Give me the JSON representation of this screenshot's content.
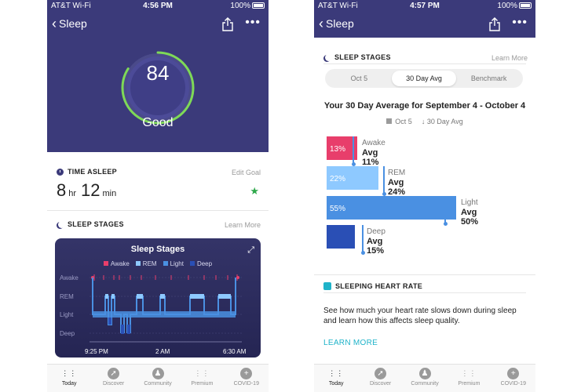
{
  "status_left": {
    "carrier": "AT&T Wi-Fi",
    "time": "4:56 PM",
    "battery": "100%"
  },
  "status_right": {
    "carrier": "AT&T Wi-Fi",
    "time": "4:57 PM",
    "battery": "100%"
  },
  "nav": {
    "back_label": "Sleep"
  },
  "score": {
    "value": "84",
    "label": "Good",
    "progress": 0.84
  },
  "time_asleep": {
    "heading": "TIME ASLEEP",
    "edit_link": "Edit Goal",
    "hours": "8",
    "hours_unit": "hr",
    "minutes": "12",
    "minutes_unit": "min"
  },
  "sleep_stages_left": {
    "heading": "SLEEP STAGES",
    "link": "Learn More",
    "chart_title": "Sleep Stages",
    "legend": [
      {
        "label": "Awake",
        "color": "#e83e6b"
      },
      {
        "label": "REM",
        "color": "#8ec9ff"
      },
      {
        "label": "Light",
        "color": "#4a90e2"
      },
      {
        "label": "Deep",
        "color": "#2a4fb5"
      }
    ],
    "row_labels": [
      "Awake",
      "REM",
      "Light",
      "Deep"
    ],
    "time_labels": [
      "9:25 PM",
      "2 AM",
      "6:30 AM"
    ]
  },
  "sleep_stages_right": {
    "heading": "SLEEP STAGES",
    "link": "Learn More",
    "tabs": [
      {
        "label": "Oct 5",
        "active": false
      },
      {
        "label": "30 Day Avg",
        "active": true
      },
      {
        "label": "Benchmark",
        "active": false
      }
    ],
    "avg_title": "Your 30 Day Average for September 4 - October 4",
    "legend_day": "Oct 5",
    "legend_avg": "30 Day Avg",
    "stages": [
      {
        "name": "Awake",
        "pct_label": "13%",
        "pct": 13,
        "avg_label": "Avg 11%",
        "avg": 11,
        "color": "#e83e6b"
      },
      {
        "name": "REM",
        "pct_label": "22%",
        "pct": 22,
        "avg_label": "Avg 24%",
        "avg": 24,
        "color": "#8ec9ff"
      },
      {
        "name": "Light",
        "pct_label": "55%",
        "pct": 55,
        "avg_label": "Avg 50%",
        "avg": 50,
        "color": "#4a90e2"
      },
      {
        "name": "Deep",
        "pct_label": "",
        "pct": 12,
        "avg_label": "Avg 15%",
        "avg": 15,
        "color": "#2a4fb5"
      }
    ]
  },
  "heart_rate": {
    "heading": "SLEEPING HEART RATE",
    "body": "See how much your heart rate slows down during sleep and learn how this affects sleep quality.",
    "link": "LEARN MORE"
  },
  "tabbar": [
    {
      "label": "Today",
      "icon": "dots-icon",
      "active": true
    },
    {
      "label": "Discover",
      "icon": "compass-icon",
      "active": false
    },
    {
      "label": "Community",
      "icon": "community-icon",
      "active": false
    },
    {
      "label": "Premium",
      "icon": "premium-icon",
      "active": false
    },
    {
      "label": "COVID-19",
      "icon": "plus-icon",
      "active": false
    }
  ]
}
